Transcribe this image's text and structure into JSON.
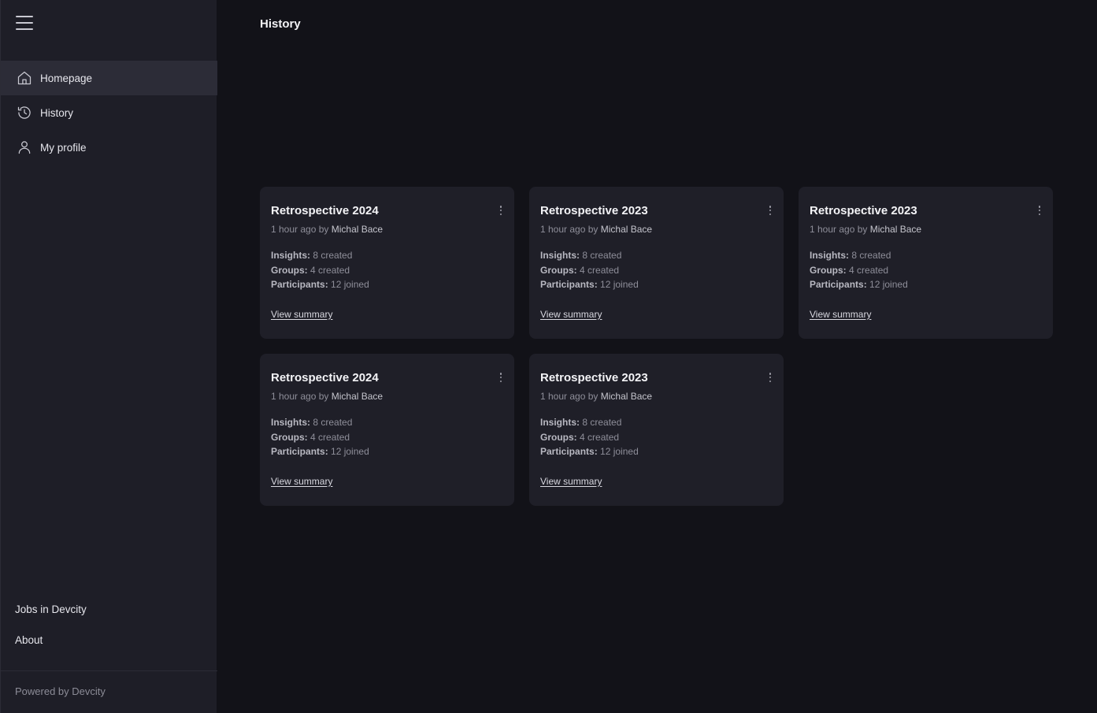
{
  "sidebar": {
    "nav": [
      {
        "label": "Homepage",
        "icon": "home-icon",
        "active": true
      },
      {
        "label": "History",
        "icon": "history-icon",
        "active": false
      },
      {
        "label": "My profile",
        "icon": "user-icon",
        "active": false
      }
    ],
    "footer_links": [
      "Jobs in Devcity",
      "About"
    ],
    "powered_by": "Powered by Devcity"
  },
  "page": {
    "title": "History"
  },
  "cards": [
    {
      "title": "Retrospective 2024",
      "time": "1 hour ago by",
      "author": "Michal Bace",
      "insights_label": "Insights:",
      "insights": "8 created",
      "groups_label": "Groups:",
      "groups": "4 created",
      "participants_label": "Participants:",
      "participants": "12 joined",
      "link": "View summary"
    },
    {
      "title": "Retrospective 2023",
      "time": "1 hour ago by",
      "author": "Michal Bace",
      "insights_label": "Insights:",
      "insights": "8 created",
      "groups_label": "Groups:",
      "groups": "4 created",
      "participants_label": "Participants:",
      "participants": "12 joined",
      "link": "View summary"
    },
    {
      "title": "Retrospective 2023",
      "time": "1 hour ago by",
      "author": "Michal Bace",
      "insights_label": "Insights:",
      "insights": "8 created",
      "groups_label": "Groups:",
      "groups": "4 created",
      "participants_label": "Participants:",
      "participants": "12 joined",
      "link": "View summary"
    },
    {
      "title": "Retrospective 2024",
      "time": "1 hour ago by",
      "author": "Michal Bace",
      "insights_label": "Insights:",
      "insights": "8 created",
      "groups_label": "Groups:",
      "groups": "4 created",
      "participants_label": "Participants:",
      "participants": "12 joined",
      "link": "View summary"
    },
    {
      "title": "Retrospective 2023",
      "time": "1 hour ago by",
      "author": "Michal Bace",
      "insights_label": "Insights:",
      "insights": "8 created",
      "groups_label": "Groups:",
      "groups": "4 created",
      "participants_label": "Participants:",
      "participants": "12 joined",
      "link": "View summary"
    }
  ],
  "colors": {
    "background": "#121218",
    "sidebar": "#1e1e27",
    "card": "#1f1f28",
    "active_nav": "#2c2c37"
  }
}
